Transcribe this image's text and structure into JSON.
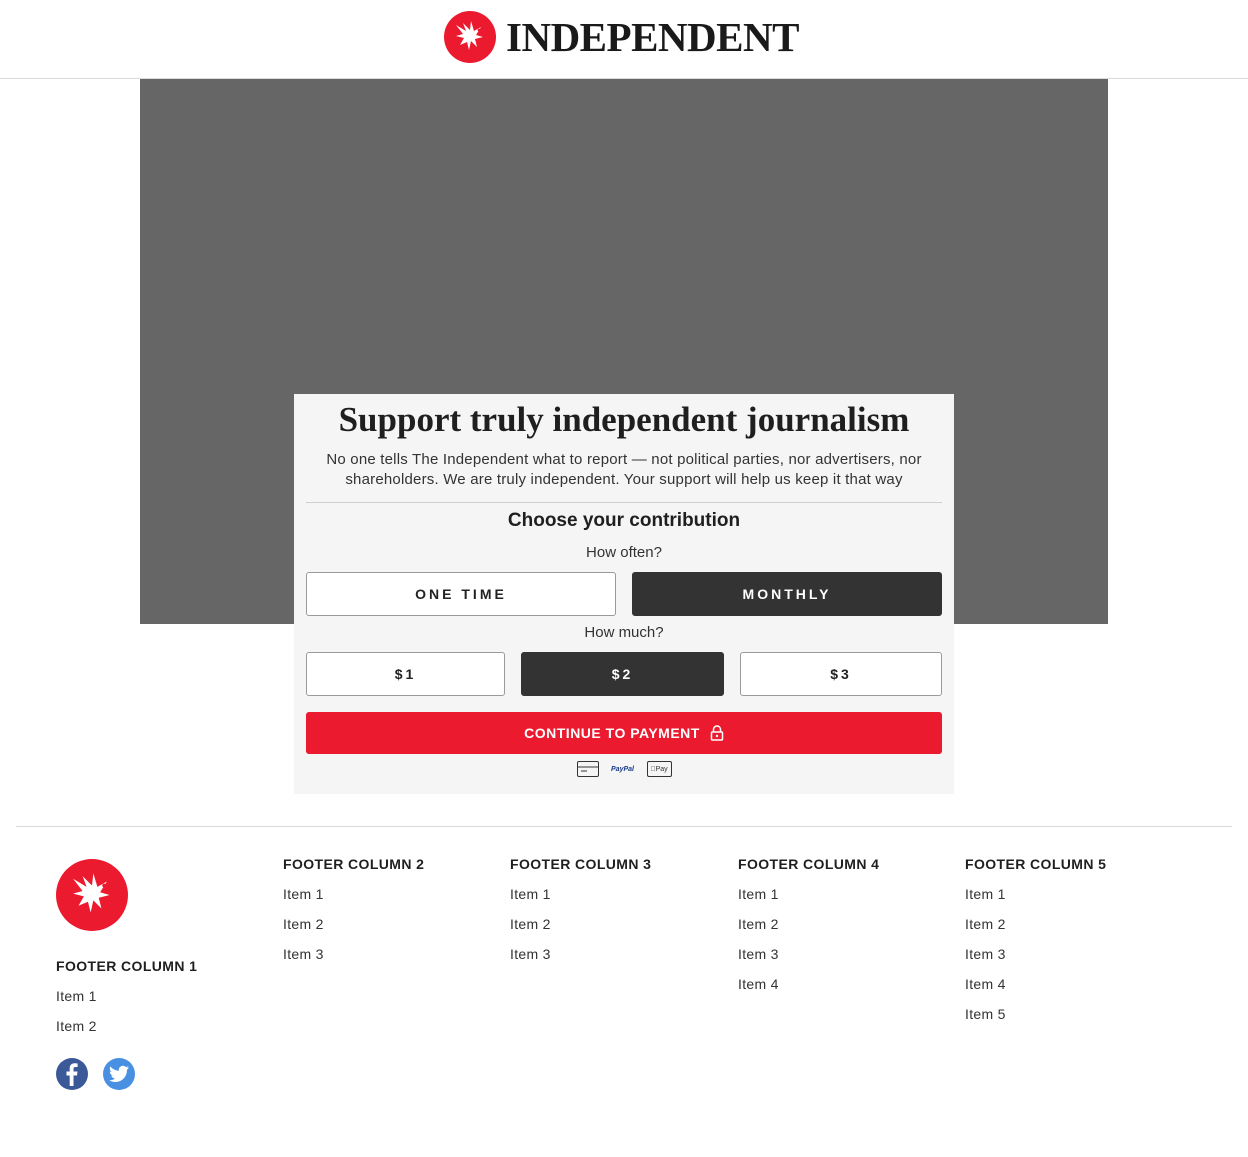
{
  "header": {
    "brand_name": "INDEPENDENT",
    "logo_icon": "eagle-icon"
  },
  "panel": {
    "title": "Support truly independent journalism",
    "description": "No one tells The Independent what to report — not political parties, nor advertisers, nor shareholders. We are truly independent. Your support will help us keep it that way",
    "choose_label": "Choose your contribution",
    "frequency_question": "How often?",
    "frequency_options": [
      {
        "label": "ONE TIME",
        "selected": false
      },
      {
        "label": "MONTHLY",
        "selected": true
      }
    ],
    "amount_question": "How much?",
    "amount_options": [
      {
        "label": "$1",
        "selected": false
      },
      {
        "label": "$2",
        "selected": true
      },
      {
        "label": "$3",
        "selected": false
      }
    ],
    "continue_label": "CONTINUE TO PAYMENT",
    "continue_icon": "lock-icon",
    "payment_methods": [
      {
        "name": "card-icon",
        "label": ""
      },
      {
        "name": "paypal-icon",
        "label": "PayPal"
      },
      {
        "name": "apple-pay-icon",
        "label": "Pay"
      }
    ]
  },
  "footer": {
    "columns": [
      {
        "title": "FOOTER COLUMN 1",
        "items": [
          "Item 1",
          "Item 2"
        ]
      },
      {
        "title": "FOOTER COLUMN 2",
        "items": [
          "Item 1",
          "Item 2",
          "Item 3"
        ]
      },
      {
        "title": "FOOTER COLUMN 3",
        "items": [
          "Item 1",
          "Item 2",
          "Item 3"
        ]
      },
      {
        "title": "FOOTER COLUMN 4",
        "items": [
          "Item 1",
          "Item 2",
          "Item 3",
          "Item 4"
        ]
      },
      {
        "title": "FOOTER COLUMN 5",
        "items": [
          "Item 1",
          "Item 2",
          "Item 3",
          "Item 4",
          "Item 5"
        ]
      }
    ],
    "social": [
      "facebook-icon",
      "twitter-icon"
    ]
  },
  "colors": {
    "brand_red": "#ec1a2e",
    "selected_dark": "#333333",
    "hero_gray": "#666666",
    "panel_bg": "#f5f5f5",
    "facebook_blue": "#3b5998",
    "twitter_blue": "#4a90e2"
  }
}
